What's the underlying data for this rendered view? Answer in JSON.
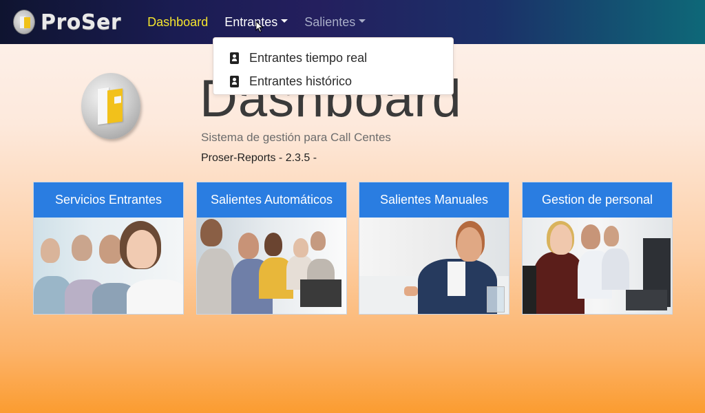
{
  "navbar": {
    "brand": "ProSer",
    "items": [
      {
        "label": "Dashboard",
        "state": "active"
      },
      {
        "label": "Entrantes",
        "state": "open"
      },
      {
        "label": "Salientes",
        "state": "muted"
      }
    ]
  },
  "dropdown": {
    "items": [
      {
        "label": "Entrantes tiempo real",
        "icon": "contact-card-icon"
      },
      {
        "label": "Entrantes histórico",
        "icon": "contact-card-icon"
      }
    ]
  },
  "hero": {
    "title": "Dashboard",
    "subtitle": "Sistema de gestión para Call Centes",
    "version": "Proser-Reports - 2.3.5 -"
  },
  "cards": [
    {
      "title": "Servicios Entrantes"
    },
    {
      "title": "Salientes Automáticos"
    },
    {
      "title": "Salientes Manuales"
    },
    {
      "title": "Gestion de personal"
    }
  ],
  "colors": {
    "nav_active": "#f5e52d",
    "card_header": "#2a7de1",
    "logo_accent": "#f2c11b"
  }
}
